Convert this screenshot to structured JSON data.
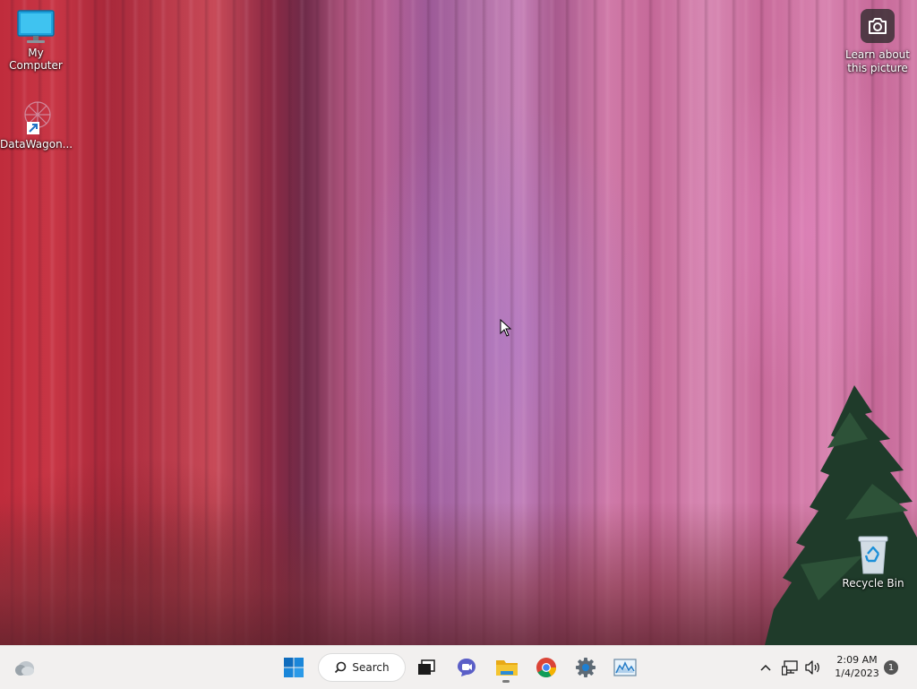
{
  "desktop": {
    "icons": [
      {
        "label": "My Computer",
        "icon": "monitor-icon"
      },
      {
        "label": "DataWagon...",
        "icon": "datawagon-shortcut-icon"
      },
      {
        "label": "Recycle Bin",
        "icon": "recycle-bin-icon"
      }
    ],
    "spotlight": {
      "label": "Learn about this picture",
      "icon": "camera-icon"
    }
  },
  "taskbar": {
    "widgets_icon": "weather-widget-icon",
    "start_icon": "windows-start-icon",
    "search_label": "Search",
    "pinned": [
      {
        "name": "task-view",
        "icon": "task-view-icon"
      },
      {
        "name": "chat",
        "icon": "chat-icon"
      },
      {
        "name": "file-explorer",
        "icon": "folder-icon",
        "active": true
      },
      {
        "name": "chrome",
        "icon": "chrome-icon"
      },
      {
        "name": "settings",
        "icon": "gear-icon"
      },
      {
        "name": "performance-monitor",
        "icon": "chart-icon"
      }
    ],
    "tray": {
      "chevron_icon": "chevron-up-icon",
      "network_icon": "network-icon",
      "volume_icon": "volume-icon",
      "time": "2:09 AM",
      "date": "1/4/2023",
      "notification_count": "1"
    }
  },
  "colors": {
    "taskbar_bg": "#f2f0ef",
    "windows_blue": "#0f6cbd",
    "folder_yellow": "#f4c531"
  }
}
